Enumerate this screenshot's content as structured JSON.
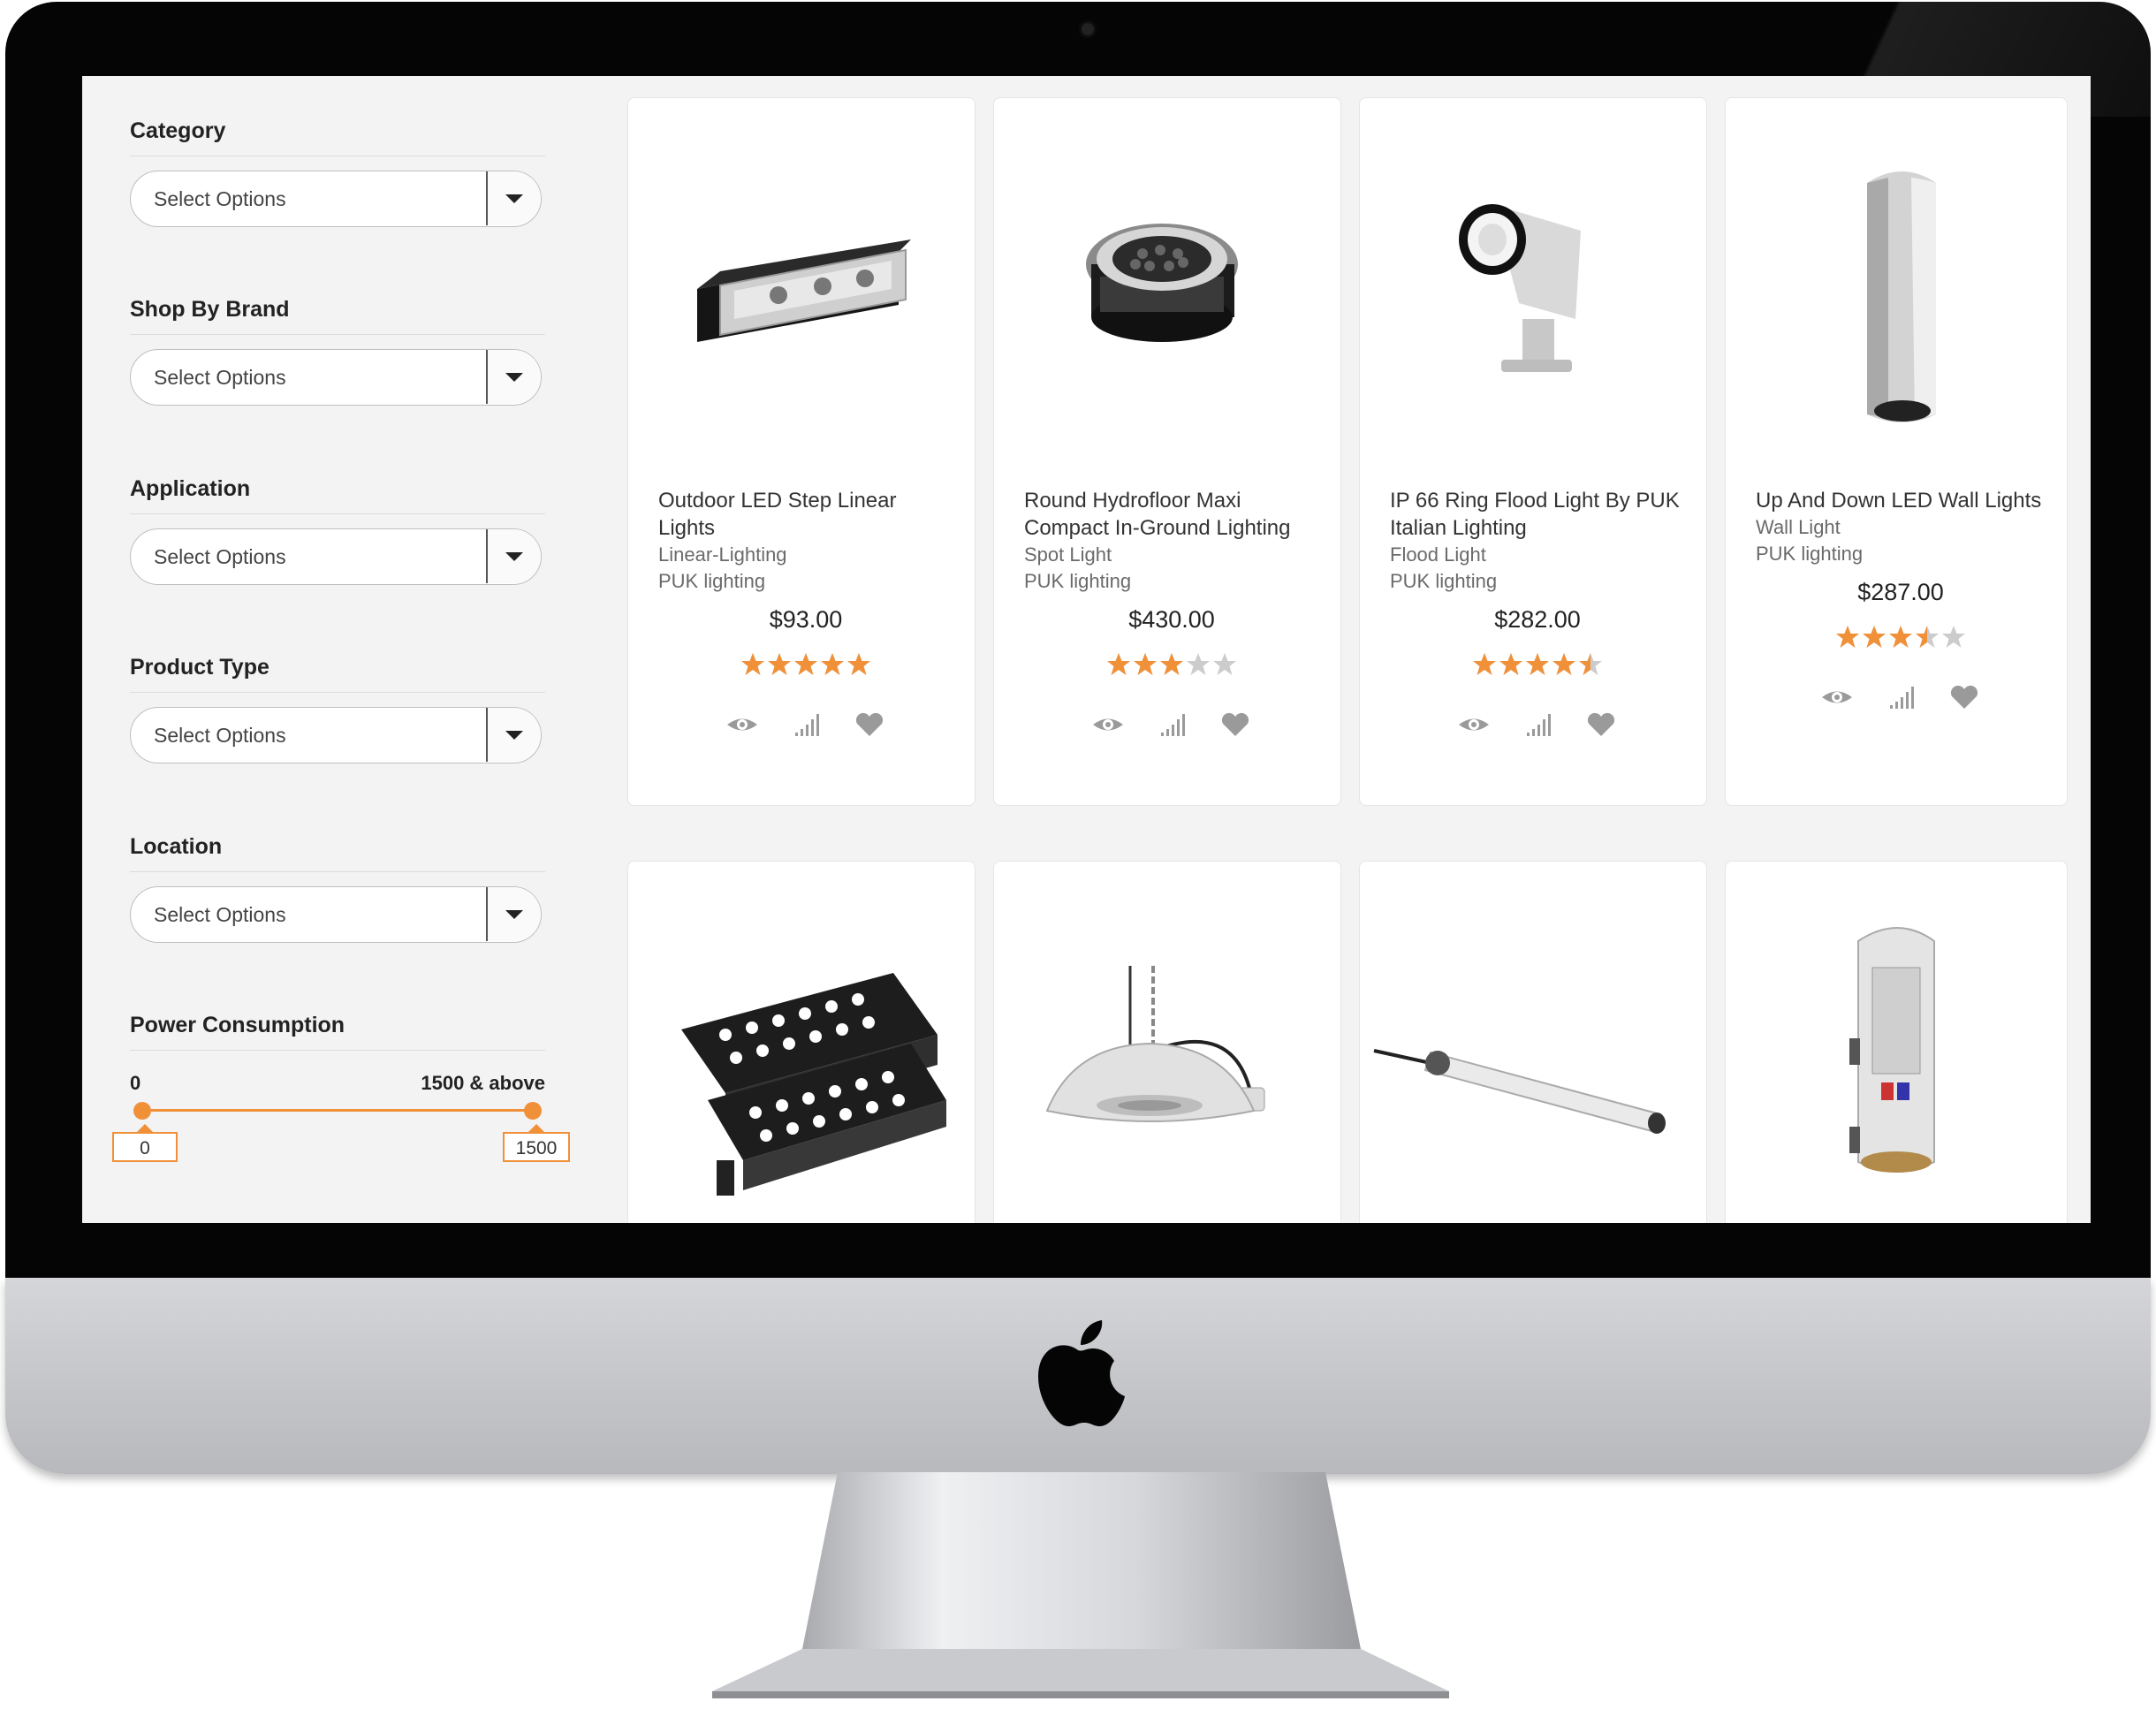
{
  "filters": [
    {
      "title": "Category",
      "placeholder": "Select Options"
    },
    {
      "title": "Shop By Brand",
      "placeholder": "Select Options"
    },
    {
      "title": "Application",
      "placeholder": "Select Options"
    },
    {
      "title": "Product Type",
      "placeholder": "Select Options"
    },
    {
      "title": "Location",
      "placeholder": "Select Options"
    }
  ],
  "power": {
    "title": "Power Consumption",
    "min_label": "0",
    "max_label": "1500 & above",
    "min_value": "0",
    "max_value": "1500"
  },
  "products": [
    {
      "name": "Outdoor LED Step Linear Lights",
      "category": "Linear-Lighting",
      "brand": "PUK lighting",
      "price": "$93.00",
      "rating": 5
    },
    {
      "name": "Round Hydrofloor Maxi Compact In-Ground Lighting",
      "category": "Spot Light",
      "brand": "PUK lighting",
      "price": "$430.00",
      "rating": 3
    },
    {
      "name": "IP 66 Ring Flood Light By PUK Italian Lighting",
      "category": "Flood Light",
      "brand": "PUK lighting",
      "price": "$282.00",
      "rating": 4.5
    },
    {
      "name": "Up And Down LED Wall Lights",
      "category": "Wall Light",
      "brand": "PUK lighting",
      "price": "$287.00",
      "rating": 3.5
    }
  ],
  "colors": {
    "accent": "#f0913a",
    "star_empty": "#cccccc",
    "icon": "#9a9a9a"
  }
}
